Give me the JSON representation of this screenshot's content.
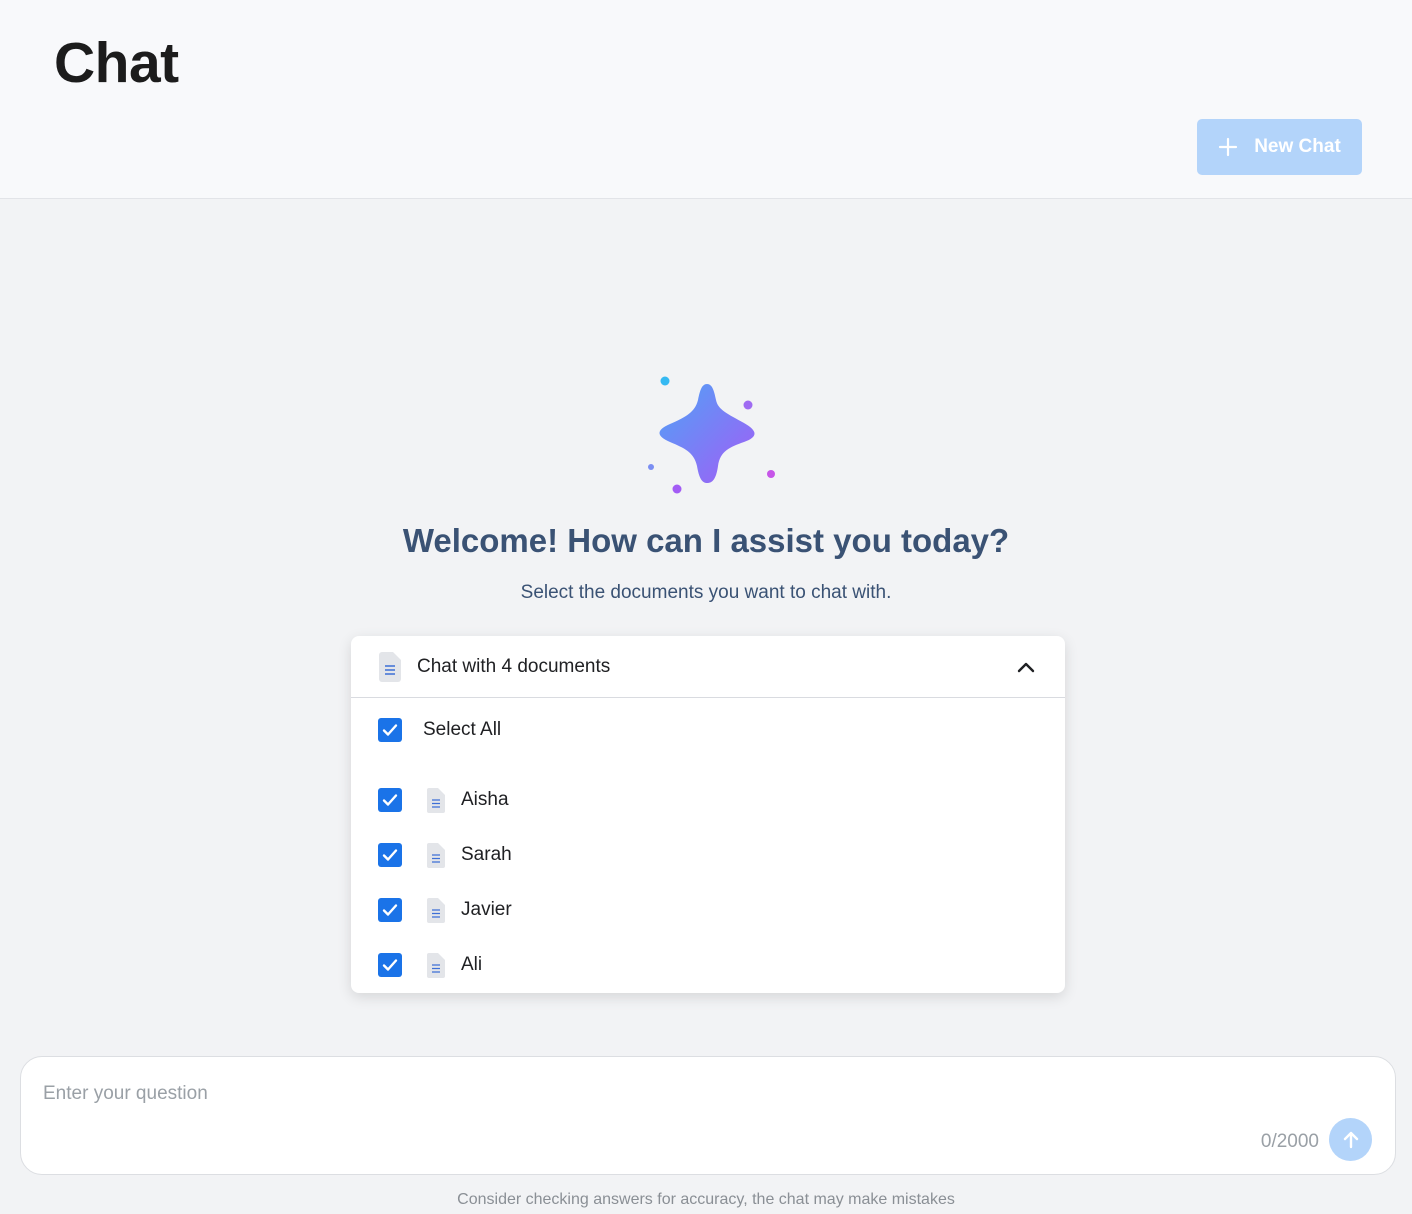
{
  "header": {
    "title": "Chat",
    "new_chat_label": "New Chat"
  },
  "welcome": {
    "heading": "Welcome! How can I assist you today?",
    "subtitle": "Select the documents you want to chat with."
  },
  "documents": {
    "summary": "Chat with 4 documents",
    "expanded": true,
    "select_all": {
      "label": "Select All",
      "checked": true
    },
    "items": [
      {
        "label": "Aisha",
        "checked": true
      },
      {
        "label": "Sarah",
        "checked": true
      },
      {
        "label": "Javier",
        "checked": true
      },
      {
        "label": "Ali",
        "checked": true
      }
    ]
  },
  "composer": {
    "placeholder": "Enter your question",
    "value": "",
    "counter": "0/2000",
    "disclaimer": "Consider checking answers for accuracy, the chat may make mistakes"
  },
  "icons": {
    "sparkle": "sparkle-icon",
    "document": "document-icon",
    "chevron": "chevron-up-icon",
    "plus": "plus-icon",
    "send": "arrow-up-icon",
    "checkbox": "check-icon"
  },
  "colors": {
    "accent": "#1a73e8",
    "accent_disabled": "#b3d4fa",
    "heading": "#3a5274"
  }
}
